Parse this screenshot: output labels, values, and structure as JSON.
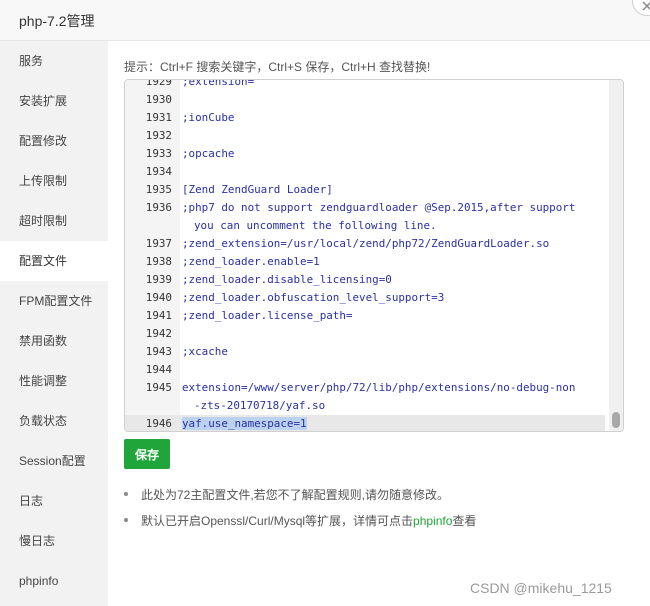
{
  "window": {
    "title": "php-7.2管理"
  },
  "sidebar": {
    "items": [
      {
        "label": "服务",
        "active": false
      },
      {
        "label": "安装扩展",
        "active": false
      },
      {
        "label": "配置修改",
        "active": false
      },
      {
        "label": "上传限制",
        "active": false
      },
      {
        "label": "超时限制",
        "active": false
      },
      {
        "label": "配置文件",
        "active": true
      },
      {
        "label": "FPM配置文件",
        "active": false
      },
      {
        "label": "禁用函数",
        "active": false
      },
      {
        "label": "性能调整",
        "active": false
      },
      {
        "label": "负载状态",
        "active": false
      },
      {
        "label": "Session配置",
        "active": false
      },
      {
        "label": "日志",
        "active": false
      },
      {
        "label": "慢日志",
        "active": false
      },
      {
        "label": "phpinfo",
        "active": false
      }
    ]
  },
  "editor": {
    "hint": "提示：Ctrl+F 搜索关键字，Ctrl+S 保存，Ctrl+H 查找替换!",
    "lines": [
      {
        "num": "1929",
        "code": ";extension="
      },
      {
        "num": "1930",
        "code": ""
      },
      {
        "num": "1931",
        "code": ";ionCube"
      },
      {
        "num": "1932",
        "code": ""
      },
      {
        "num": "1933",
        "code": ";opcache"
      },
      {
        "num": "1934",
        "code": ""
      },
      {
        "num": "1935",
        "code": "[Zend ZendGuard Loader]"
      },
      {
        "num": "1936",
        "code": ";php7 do not support zendguardloader @Sep.2015,after support"
      },
      {
        "num": "",
        "code": "you can uncomment the following line.",
        "wrap": true
      },
      {
        "num": "1937",
        "code": ";zend_extension=/usr/local/zend/php72/ZendGuardLoader.so"
      },
      {
        "num": "1938",
        "code": ";zend_loader.enable=1"
      },
      {
        "num": "1939",
        "code": ";zend_loader.disable_licensing=0"
      },
      {
        "num": "1940",
        "code": ";zend_loader.obfuscation_level_support=3"
      },
      {
        "num": "1941",
        "code": ";zend_loader.license_path="
      },
      {
        "num": "1942",
        "code": ""
      },
      {
        "num": "1943",
        "code": ";xcache"
      },
      {
        "num": "1944",
        "code": ""
      },
      {
        "num": "1945",
        "code": "extension=/www/server/php/72/lib/php/extensions/no-debug-non"
      },
      {
        "num": "",
        "code": "-zts-20170718/yaf.so",
        "wrap": true
      },
      {
        "num": "1946",
        "code": "yaf.use_namespace=1",
        "highlight": true
      }
    ]
  },
  "actions": {
    "save_label": "保存"
  },
  "notes": {
    "note1": "此处为72主配置文件,若您不了解配置规则,请勿随意修改。",
    "note2_prefix": "默认已开启Openssl/Curl/Mysql等扩展，详情可点击",
    "note2_link": "phpinfo",
    "note2_suffix": "查看"
  },
  "watermark": "CSDN @mikehu_1215",
  "colors": {
    "accent": "#20a53a",
    "code_text": "#2a30a6",
    "selection": "#bcd2ee"
  }
}
